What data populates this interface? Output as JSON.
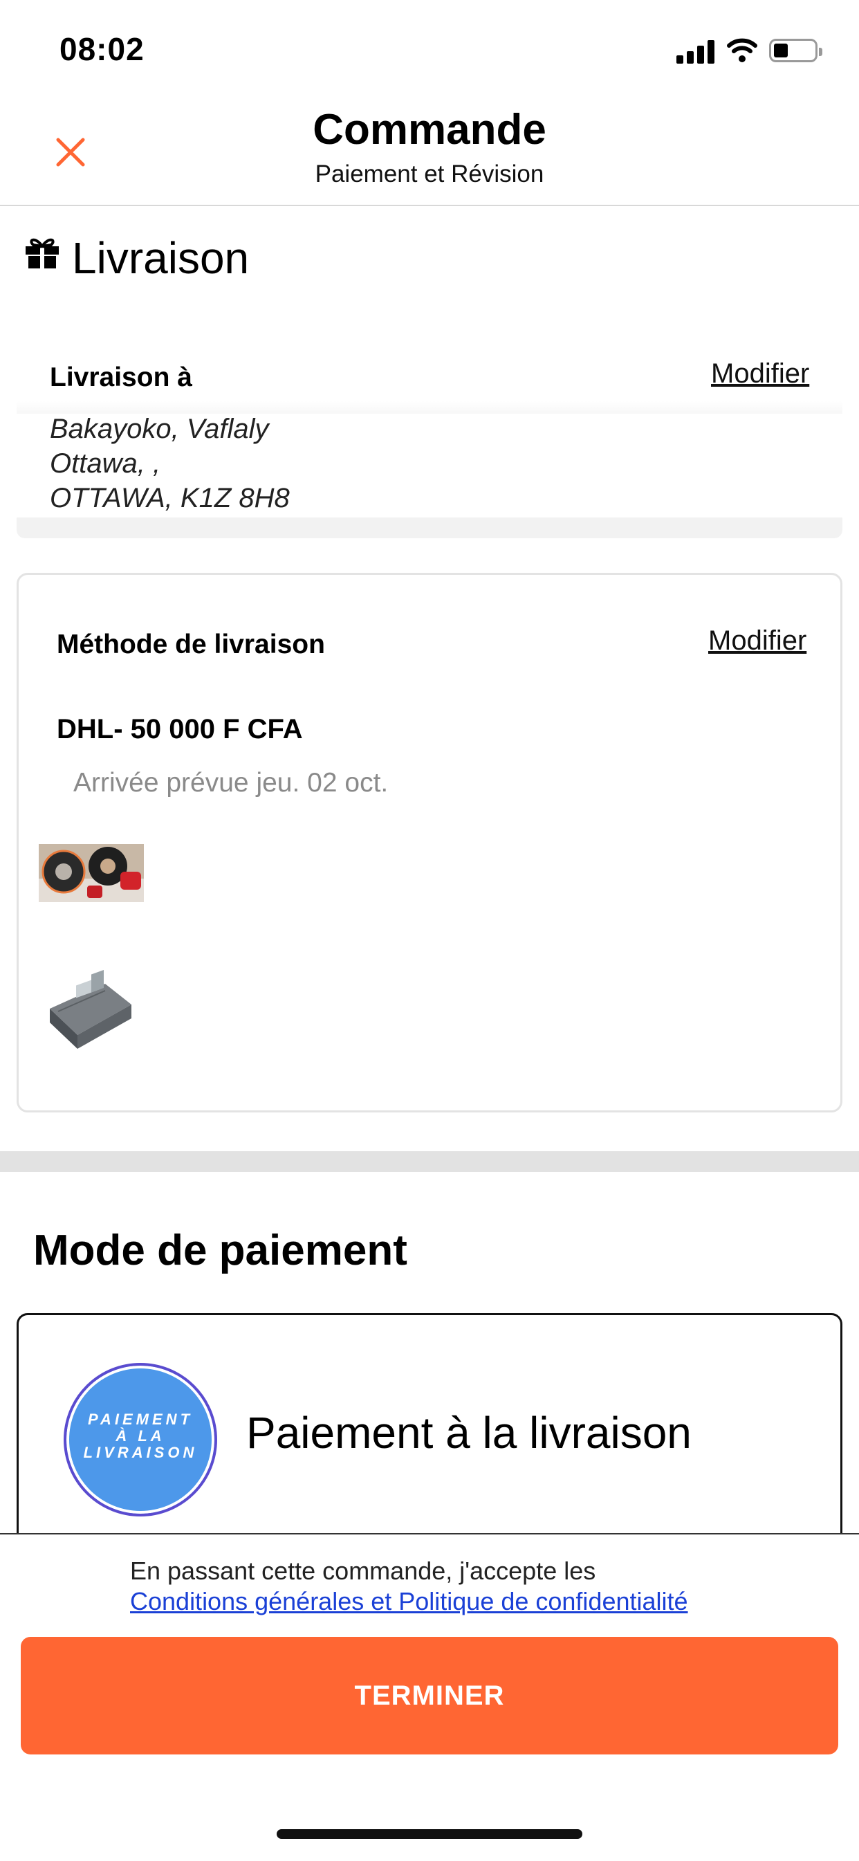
{
  "status_bar": {
    "time": "08:02",
    "signal_icon": "cellular-signal-icon",
    "wifi_icon": "wifi-icon",
    "battery_icon": "battery-icon"
  },
  "header": {
    "title": "Commande",
    "subtitle": "Paiement et Révision",
    "close_icon": "close-icon"
  },
  "delivery": {
    "section_title": "Livraison",
    "section_icon": "gift-icon",
    "address": {
      "label": "Livraison à",
      "modify_label": "Modifier",
      "lines": [
        "Bakayoko, Vaflaly",
        "Ottawa, ,",
        "OTTAWA, K1Z 8H8"
      ]
    },
    "method": {
      "label": "Méthode de livraison",
      "modify_label": "Modifier",
      "price": "DHL- 50 000 F CFA",
      "eta": "Arrivée prévue jeu. 02 oct.",
      "items": [
        "brake-discs-thumbnail",
        "control-unit-thumbnail"
      ]
    }
  },
  "payment": {
    "section_title": "Mode de paiement",
    "option_label": "Paiement à la livraison",
    "logo_lines": [
      "PAIEMENT",
      "À LA",
      "LIVRAISON"
    ]
  },
  "footer": {
    "terms_text": "En passant cette commande, j'accepte les",
    "terms_link": "Conditions générales et Politique de confidentialité",
    "submit_label": "TERMINER",
    "accent_color": "#ff6633",
    "link_color": "#1a40d6"
  }
}
